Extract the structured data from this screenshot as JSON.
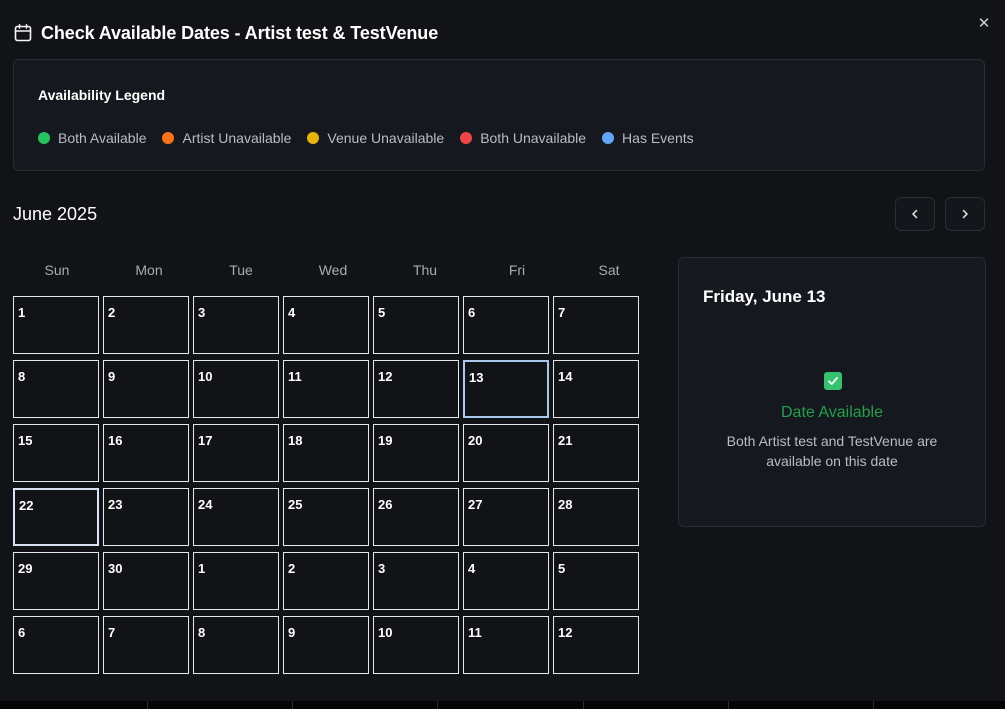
{
  "header": {
    "title": "Check Available Dates - Artist test & TestVenue",
    "close_label": "✕"
  },
  "legend": {
    "title": "Availability Legend",
    "items": [
      {
        "label": "Both Available",
        "color": "#22c55e"
      },
      {
        "label": "Artist Unavailable",
        "color": "#f97316"
      },
      {
        "label": "Venue Unavailable",
        "color": "#eab308"
      },
      {
        "label": "Both Unavailable",
        "color": "#ef4444"
      },
      {
        "label": "Has Events",
        "color": "#60a5fa"
      }
    ]
  },
  "calendar": {
    "month_label": "June 2025",
    "prev_icon": "chevron-left-icon",
    "next_icon": "chevron-right-icon",
    "weekdays": [
      "Sun",
      "Mon",
      "Tue",
      "Wed",
      "Thu",
      "Fri",
      "Sat"
    ],
    "weeks": [
      [
        "1",
        "2",
        "3",
        "4",
        "5",
        "6",
        "7"
      ],
      [
        "8",
        "9",
        "10",
        "11",
        "12",
        "13",
        "14"
      ],
      [
        "15",
        "16",
        "17",
        "18",
        "19",
        "20",
        "21"
      ],
      [
        "22",
        "23",
        "24",
        "25",
        "26",
        "27",
        "28"
      ],
      [
        "29",
        "30",
        "1",
        "2",
        "3",
        "4",
        "5"
      ],
      [
        "6",
        "7",
        "8",
        "9",
        "10",
        "11",
        "12"
      ]
    ],
    "selected_day": "13",
    "today_day": "22"
  },
  "detail": {
    "date_heading": "Friday, June 13",
    "status": "Date Available",
    "status_color": "#22a047",
    "check_color": "#34c26e",
    "description": "Both Artist test and TestVenue are available on this date"
  }
}
